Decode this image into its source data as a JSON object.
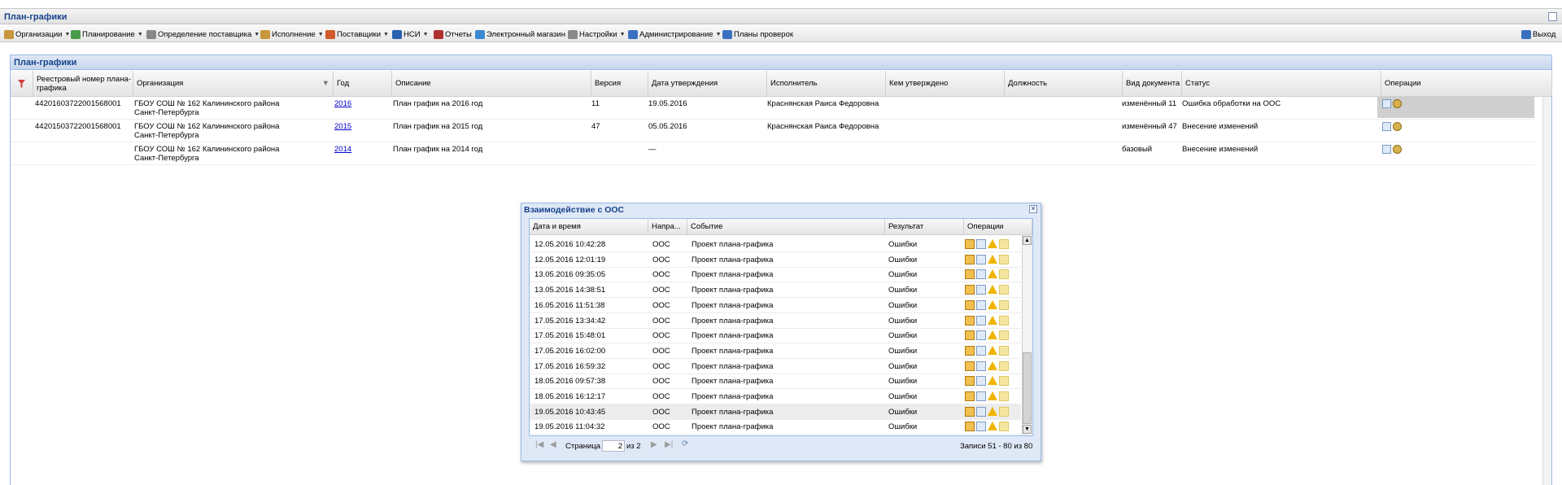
{
  "app": {
    "title": "План-графики"
  },
  "menu": {
    "items": [
      {
        "label": "Организации",
        "icon": "building-icon",
        "color": "#c8963c"
      },
      {
        "label": "Планирование",
        "icon": "planning-icon",
        "color": "#4a9a4a"
      },
      {
        "label": "Определение поставщика",
        "icon": "gears-icon",
        "color": "#888888"
      },
      {
        "label": "Исполнение",
        "icon": "execution-icon",
        "color": "#c8963c"
      },
      {
        "label": "Поставщики",
        "icon": "supplier-icon",
        "color": "#d05a2a"
      },
      {
        "label": "НСИ",
        "icon": "book-icon",
        "color": "#2a60b0"
      },
      {
        "label": "Отчеты",
        "icon": "report-icon",
        "color": "#b03030"
      },
      {
        "label": "Электронный магазин",
        "icon": "shop-icon",
        "color": "#3a8ad0"
      },
      {
        "label": "Настройки",
        "icon": "wrench-icon",
        "color": "#8a8a8a"
      },
      {
        "label": "Администрирование",
        "icon": "admin-icon",
        "color": "#3a70c0"
      },
      {
        "label": "Планы проверок",
        "icon": "person-icon",
        "color": "#3a70c0"
      }
    ],
    "exit_label": "Выход"
  },
  "panel": {
    "title": "План-графики"
  },
  "grid": {
    "columns": [
      "Реестровый номер плана-графика",
      "Организация",
      "Год",
      "Описание",
      "Версия",
      "Дата утверждения",
      "Исполнитель",
      "Кем утверждено",
      "Должность",
      "Вид документа",
      "Статус",
      "Операции"
    ],
    "rows": [
      {
        "reg": "44201603722001568001",
        "org": "ГБОУ СОШ № 162 Калининского района Санкт-Петербурга",
        "year": "2016",
        "desc": "План график на 2016 год",
        "ver": "11",
        "date": "19.05.2016",
        "exec": "Краснянская Раиса Федоровна",
        "approved": "",
        "pos": "",
        "doctype": "изменённый 11",
        "status": "Ошибка обработки на ООС"
      },
      {
        "reg": "44201503722001568001",
        "org": "ГБОУ СОШ № 162 Калининского района Санкт-Петербурга",
        "year": "2015",
        "desc": "План график на 2015 год",
        "ver": "47",
        "date": "05.05.2016",
        "exec": "Краснянская Раиса Федоровна",
        "approved": "",
        "pos": "",
        "doctype": "изменённый 47",
        "status": "Внесение изменений"
      },
      {
        "reg": "",
        "org": "ГБОУ СОШ № 162 Калининского района Санкт-Петербурга",
        "year": "2014",
        "desc": "План график на 2014 год",
        "ver": "",
        "date": "—",
        "exec": "",
        "approved": "",
        "pos": "",
        "doctype": "базовый",
        "status": "Внесение изменений"
      }
    ]
  },
  "dialog": {
    "title": "Взаимодействие с ООС",
    "columns": [
      "Дата и время",
      "Напра...",
      "Событие",
      "Результат",
      "Операции"
    ],
    "rows": [
      {
        "dt": "12.05.2016 10:42:28",
        "dir": "ООС",
        "event": "Проект плана-графика",
        "result": "Ошибки"
      },
      {
        "dt": "12.05.2016 12:01:19",
        "dir": "ООС",
        "event": "Проект плана-графика",
        "result": "Ошибки"
      },
      {
        "dt": "13.05.2016 09:35:05",
        "dir": "ООС",
        "event": "Проект плана-графика",
        "result": "Ошибки"
      },
      {
        "dt": "13.05.2016 14:38:51",
        "dir": "ООС",
        "event": "Проект плана-графика",
        "result": "Ошибки"
      },
      {
        "dt": "16.05.2016 11:51:38",
        "dir": "ООС",
        "event": "Проект плана-графика",
        "result": "Ошибки"
      },
      {
        "dt": "17.05.2016 13:34:42",
        "dir": "ООС",
        "event": "Проект плана-графика",
        "result": "Ошибки"
      },
      {
        "dt": "17.05.2016 15:48:01",
        "dir": "ООС",
        "event": "Проект плана-графика",
        "result": "Ошибки"
      },
      {
        "dt": "17.05.2016 16:02:00",
        "dir": "ООС",
        "event": "Проект плана-графика",
        "result": "Ошибки"
      },
      {
        "dt": "17.05.2016 16:59:32",
        "dir": "ООС",
        "event": "Проект плана-графика",
        "result": "Ошибки"
      },
      {
        "dt": "18.05.2016 09:57:38",
        "dir": "ООС",
        "event": "Проект плана-графика",
        "result": "Ошибки"
      },
      {
        "dt": "18.05.2016 16:12:17",
        "dir": "ООС",
        "event": "Проект плана-графика",
        "result": "Ошибки"
      },
      {
        "dt": "19.05.2016 10:43:45",
        "dir": "ООС",
        "event": "Проект плана-графика",
        "result": "Ошибки"
      },
      {
        "dt": "19.05.2016 11:04:32",
        "dir": "ООС",
        "event": "Проект плана-графика",
        "result": "Ошибки"
      }
    ],
    "selected_row": 11,
    "pager": {
      "page_label": "Страница",
      "page_value": "2",
      "of_label": "из 2",
      "records": "Записи 51 - 80 из 80"
    }
  }
}
